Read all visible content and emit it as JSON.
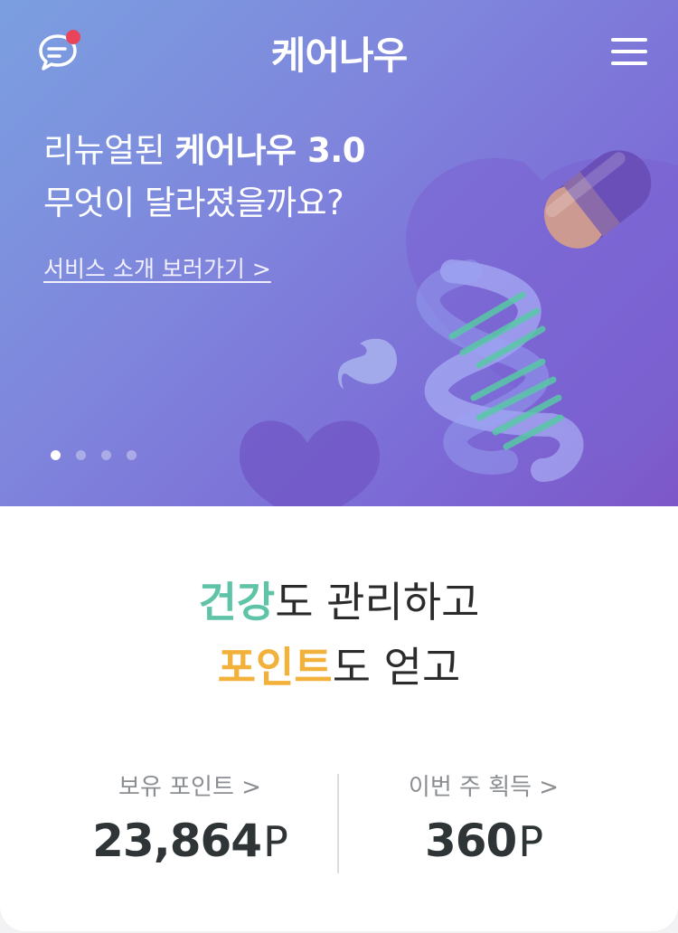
{
  "header": {
    "logo_text": "케어나우",
    "chat_icon": "chat-bubble-icon",
    "menu_icon": "hamburger-menu-icon",
    "accent_dot_color": "#e9445a"
  },
  "banner": {
    "line1_pre": "리뉴얼된 ",
    "line1_bold": "케어나우 3.0",
    "line2": "무엇이 달라졌을까요?",
    "link": "서비스 소개 보러가기 >",
    "slides_total": 4,
    "slides_active": 1
  },
  "slogan": {
    "line1_highlight": "건강",
    "line1_rest": "도 관리하고",
    "line2_highlight": "포인트",
    "line2_rest": "도 얻고",
    "color_health": "#5fc4a7",
    "color_points": "#f2b13a"
  },
  "stats": {
    "held_label": "보유 포인트 >",
    "held_value": "23,864",
    "weekly_label": "이번 주 획득 >",
    "weekly_value": "360",
    "unit": "P"
  }
}
